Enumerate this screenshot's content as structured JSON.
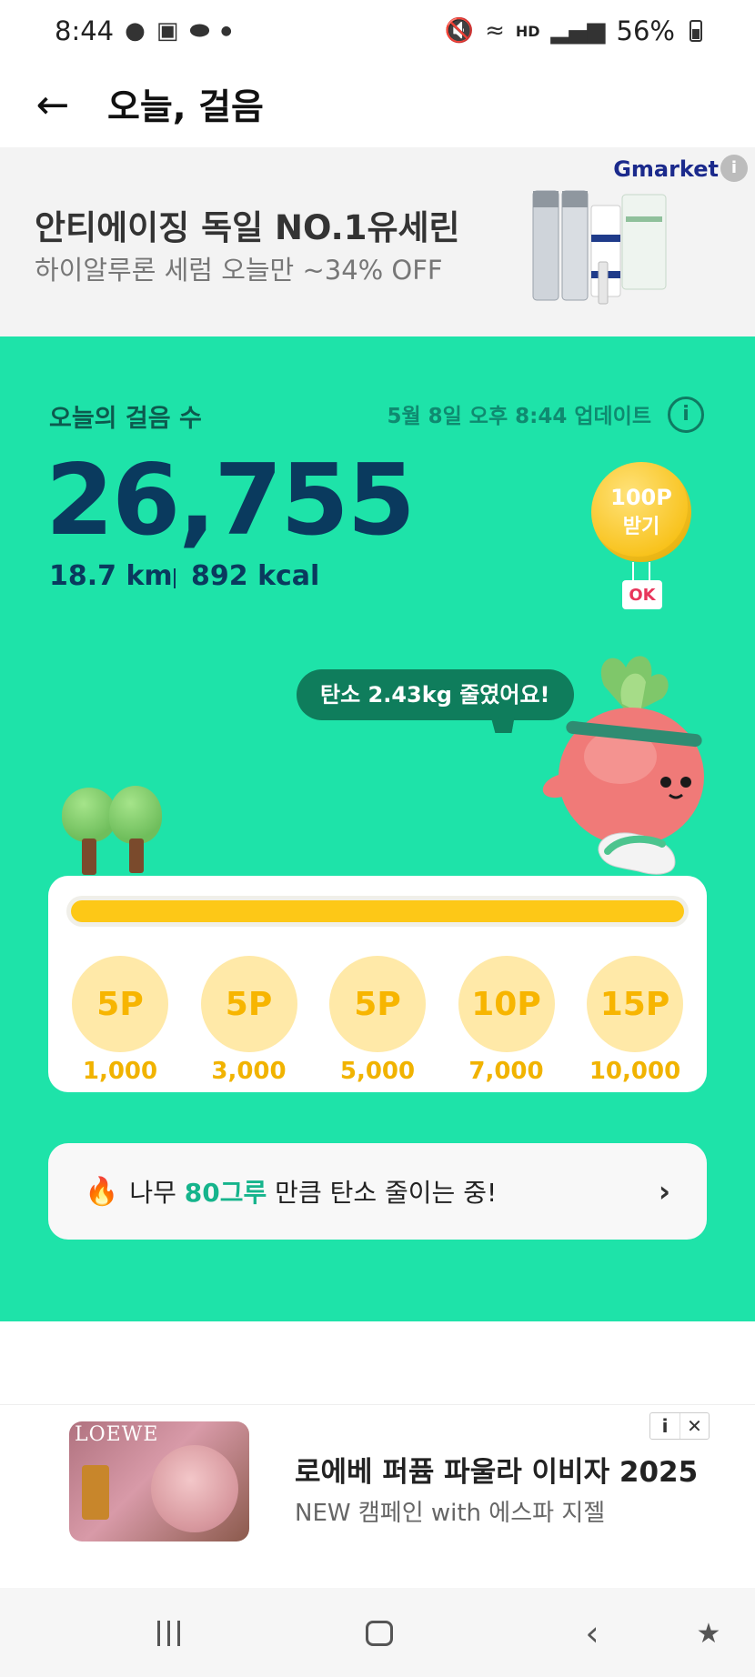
{
  "status_bar": {
    "time": "8:44",
    "battery": "56%",
    "hd_label": "HD"
  },
  "header": {
    "back_icon": "←",
    "title": "오늘, 걸음"
  },
  "ad_top": {
    "brand": "Gmarket",
    "title": "안티에이징 독일 NO.1유세린",
    "subtitle": "하이알루론 세럼 오늘만 ~34% OFF",
    "info_icon": "i"
  },
  "steps": {
    "label": "오늘의 걸음 수",
    "updated": "5월 8일 오후 8:44 업데이트",
    "count": "26,755",
    "distance": "18.7 km",
    "calories": "892 kcal",
    "balloon_points": "100P",
    "balloon_action": "받기",
    "ok_badge": "OK",
    "speech": "탄소 2.43kg 줄였어요!",
    "progress": 1.0,
    "progress_color": "#fdc817",
    "panel_color": "#1ee3a9"
  },
  "milestones": [
    {
      "points": "5P",
      "steps": "1,000"
    },
    {
      "points": "5P",
      "steps": "3,000"
    },
    {
      "points": "5P",
      "steps": "5,000"
    },
    {
      "points": "10P",
      "steps": "7,000"
    },
    {
      "points": "15P",
      "steps": "10,000"
    }
  ],
  "carbon": {
    "prefix": "나무 ",
    "highlight": "80그루",
    "suffix": " 만큼 탄소 줄이는 중!"
  },
  "ad_bottom": {
    "thumb_brand": "LOEWE",
    "title": "로에베 퍼퓸 파울라 이비자 2025",
    "subtitle": "NEW 캠페인 with 에스파 지젤",
    "info_icon": "i",
    "close_icon": "✕"
  }
}
